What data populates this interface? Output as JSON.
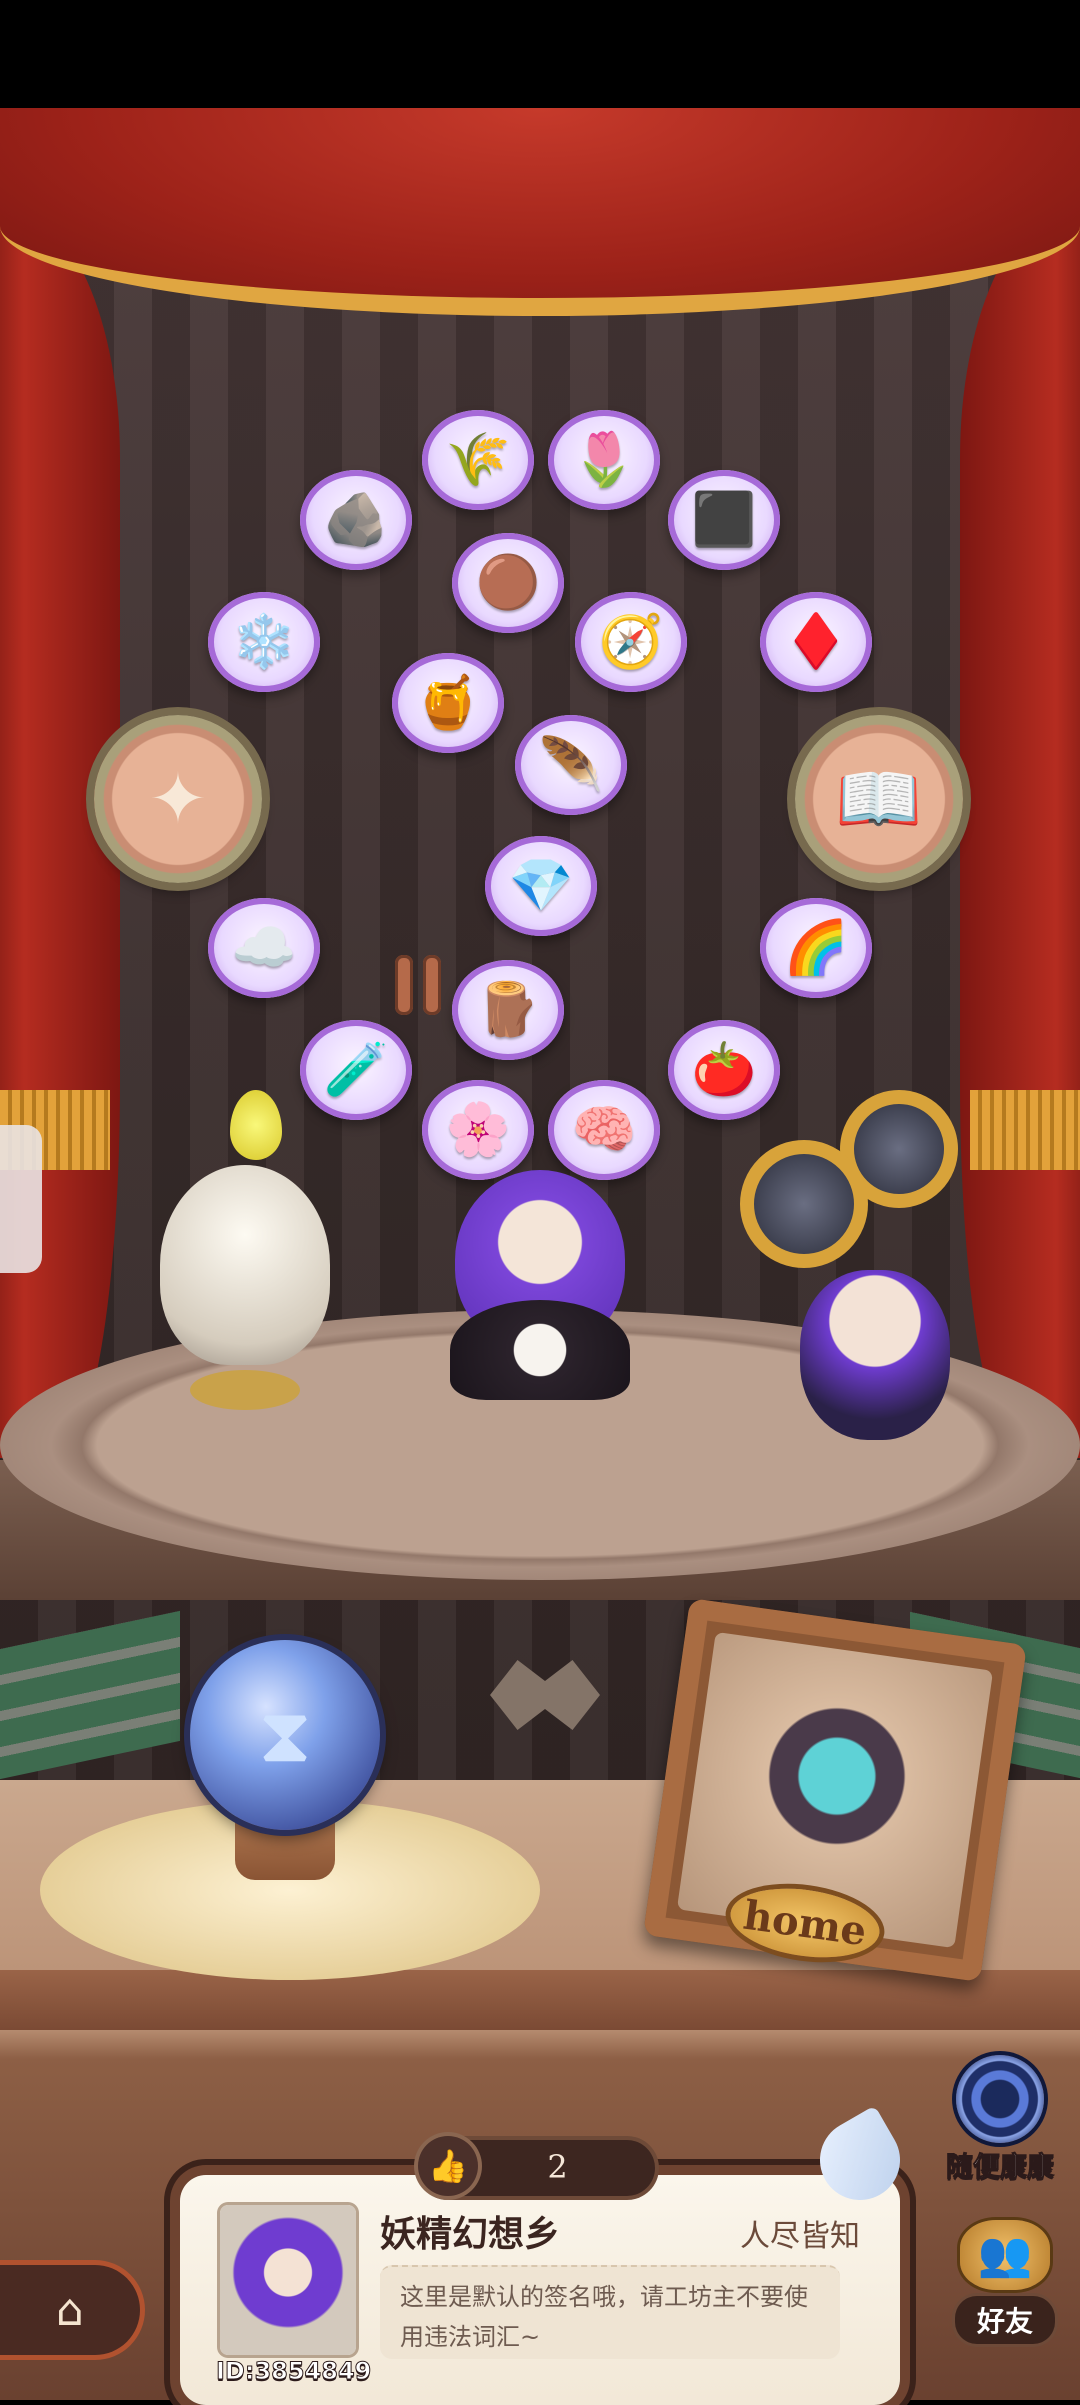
{
  "ingredients": [
    {
      "id": "wheat",
      "icon": "🌾"
    },
    {
      "id": "lily",
      "icon": "🌷"
    },
    {
      "id": "copper-ore",
      "icon": "🪨"
    },
    {
      "id": "coal",
      "icon": "⬛"
    },
    {
      "id": "dirt-pile",
      "icon": "🟤"
    },
    {
      "id": "ice-crystal",
      "icon": "❄️"
    },
    {
      "id": "compass",
      "icon": "🧭"
    },
    {
      "id": "red-crystals",
      "icon": "♦️"
    },
    {
      "id": "honeycomb",
      "icon": "🍯"
    },
    {
      "id": "dark-feather",
      "icon": "🪶"
    },
    {
      "id": "quartz",
      "icon": "💎"
    },
    {
      "id": "cloud",
      "icon": "☁️"
    },
    {
      "id": "rainbow-ribbon",
      "icon": "🌈"
    },
    {
      "id": "wood-plank",
      "icon": "🪵"
    },
    {
      "id": "potion-bottle",
      "icon": "🧪"
    },
    {
      "id": "tomato",
      "icon": "🍅"
    },
    {
      "id": "purple-flower",
      "icon": "🌸"
    },
    {
      "id": "pink-brain",
      "icon": "🧠"
    }
  ],
  "left_medal_icon": "fairy-silhouette-icon",
  "right_medal_icon": "book-icon",
  "home_label": "home",
  "random_visit_label": "随便康康",
  "like_count": "2",
  "profile": {
    "name": "妖精幻想乡",
    "tag": "人尽皆知",
    "id_label": "ID:3854849",
    "signature": "这里是默认的签名哦，请工坊主不要使用违法词汇~"
  },
  "friends_label": "好友"
}
